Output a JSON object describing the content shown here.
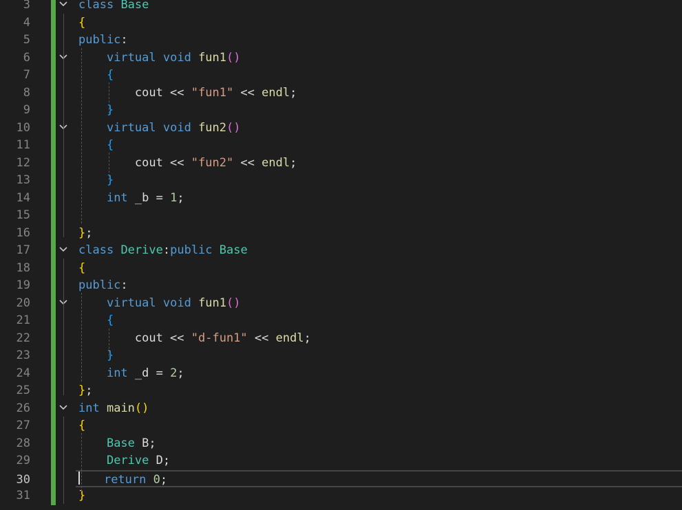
{
  "editor": {
    "current_line": "30",
    "lines": [
      {
        "n": "3",
        "fold": true,
        "tokens": [
          [
            "kw",
            "class"
          ],
          [
            "p",
            " "
          ],
          [
            "ty",
            "Base"
          ]
        ]
      },
      {
        "n": "4",
        "fold": false,
        "tokens": [
          [
            "br1",
            "{"
          ]
        ]
      },
      {
        "n": "5",
        "fold": false,
        "tokens": [
          [
            "kw",
            "public"
          ],
          [
            "p",
            ":"
          ]
        ]
      },
      {
        "n": "6",
        "fold": true,
        "tokens": [
          [
            "p",
            "    "
          ],
          [
            "kw",
            "virtual"
          ],
          [
            "p",
            " "
          ],
          [
            "kw",
            "void"
          ],
          [
            "p",
            " "
          ],
          [
            "fn",
            "fun1"
          ],
          [
            "br2",
            "()"
          ]
        ]
      },
      {
        "n": "7",
        "fold": false,
        "tokens": [
          [
            "p",
            "    "
          ],
          [
            "br3",
            "{"
          ]
        ]
      },
      {
        "n": "8",
        "fold": false,
        "tokens": [
          [
            "p",
            "        cout << "
          ],
          [
            "str",
            "\"fun1\""
          ],
          [
            "p",
            " << "
          ],
          [
            "fn",
            "endl"
          ],
          [
            "p",
            ";"
          ]
        ]
      },
      {
        "n": "9",
        "fold": false,
        "tokens": [
          [
            "p",
            "    "
          ],
          [
            "br3",
            "}"
          ]
        ]
      },
      {
        "n": "10",
        "fold": true,
        "tokens": [
          [
            "p",
            "    "
          ],
          [
            "kw",
            "virtual"
          ],
          [
            "p",
            " "
          ],
          [
            "kw",
            "void"
          ],
          [
            "p",
            " "
          ],
          [
            "fn",
            "fun2"
          ],
          [
            "br2",
            "()"
          ]
        ]
      },
      {
        "n": "11",
        "fold": false,
        "tokens": [
          [
            "p",
            "    "
          ],
          [
            "br3",
            "{"
          ]
        ]
      },
      {
        "n": "12",
        "fold": false,
        "tokens": [
          [
            "p",
            "        cout << "
          ],
          [
            "str",
            "\"fun2\""
          ],
          [
            "p",
            " << "
          ],
          [
            "fn",
            "endl"
          ],
          [
            "p",
            ";"
          ]
        ]
      },
      {
        "n": "13",
        "fold": false,
        "tokens": [
          [
            "p",
            "    "
          ],
          [
            "br3",
            "}"
          ]
        ]
      },
      {
        "n": "14",
        "fold": false,
        "tokens": [
          [
            "p",
            "    "
          ],
          [
            "kw",
            "int"
          ],
          [
            "p",
            " _b = "
          ],
          [
            "num",
            "1"
          ],
          [
            "p",
            ";"
          ]
        ]
      },
      {
        "n": "15",
        "fold": false,
        "tokens": []
      },
      {
        "n": "16",
        "fold": false,
        "tokens": [
          [
            "br1",
            "}"
          ],
          [
            "p",
            ";"
          ]
        ]
      },
      {
        "n": "17",
        "fold": true,
        "tokens": [
          [
            "kw",
            "class"
          ],
          [
            "p",
            " "
          ],
          [
            "ty",
            "Derive"
          ],
          [
            "p",
            ":"
          ],
          [
            "kw",
            "public"
          ],
          [
            "p",
            " "
          ],
          [
            "ty",
            "Base"
          ]
        ]
      },
      {
        "n": "18",
        "fold": false,
        "tokens": [
          [
            "br1",
            "{"
          ]
        ]
      },
      {
        "n": "19",
        "fold": false,
        "tokens": [
          [
            "kw",
            "public"
          ],
          [
            "p",
            ":"
          ]
        ]
      },
      {
        "n": "20",
        "fold": true,
        "tokens": [
          [
            "p",
            "    "
          ],
          [
            "kw",
            "virtual"
          ],
          [
            "p",
            " "
          ],
          [
            "kw",
            "void"
          ],
          [
            "p",
            " "
          ],
          [
            "fn",
            "fun1"
          ],
          [
            "br2",
            "()"
          ]
        ]
      },
      {
        "n": "21",
        "fold": false,
        "tokens": [
          [
            "p",
            "    "
          ],
          [
            "br3",
            "{"
          ]
        ]
      },
      {
        "n": "22",
        "fold": false,
        "tokens": [
          [
            "p",
            "        cout << "
          ],
          [
            "str",
            "\"d-fun1\""
          ],
          [
            "p",
            " << "
          ],
          [
            "fn",
            "endl"
          ],
          [
            "p",
            ";"
          ]
        ]
      },
      {
        "n": "23",
        "fold": false,
        "tokens": [
          [
            "p",
            "    "
          ],
          [
            "br3",
            "}"
          ]
        ]
      },
      {
        "n": "24",
        "fold": false,
        "tokens": [
          [
            "p",
            "    "
          ],
          [
            "kw",
            "int"
          ],
          [
            "p",
            " _d = "
          ],
          [
            "num",
            "2"
          ],
          [
            "p",
            ";"
          ]
        ]
      },
      {
        "n": "25",
        "fold": false,
        "tokens": [
          [
            "br1",
            "}"
          ],
          [
            "p",
            ";"
          ]
        ]
      },
      {
        "n": "26",
        "fold": true,
        "tokens": [
          [
            "kw",
            "int"
          ],
          [
            "p",
            " "
          ],
          [
            "fn",
            "main"
          ],
          [
            "br1",
            "()"
          ]
        ]
      },
      {
        "n": "27",
        "fold": false,
        "tokens": [
          [
            "br1",
            "{"
          ]
        ]
      },
      {
        "n": "28",
        "fold": false,
        "tokens": [
          [
            "p",
            "    "
          ],
          [
            "ty",
            "Base"
          ],
          [
            "p",
            " B;"
          ]
        ]
      },
      {
        "n": "29",
        "fold": false,
        "tokens": [
          [
            "p",
            "    "
          ],
          [
            "ty",
            "Derive"
          ],
          [
            "p",
            " D;"
          ]
        ]
      },
      {
        "n": "30",
        "fold": false,
        "tokens": [
          [
            "p",
            "    "
          ],
          [
            "kw",
            "return"
          ],
          [
            "p",
            " "
          ],
          [
            "num",
            "0"
          ],
          [
            "p",
            ";"
          ]
        ]
      },
      {
        "n": "31",
        "fold": false,
        "tokens": [
          [
            "br1",
            "}"
          ]
        ]
      }
    ]
  }
}
